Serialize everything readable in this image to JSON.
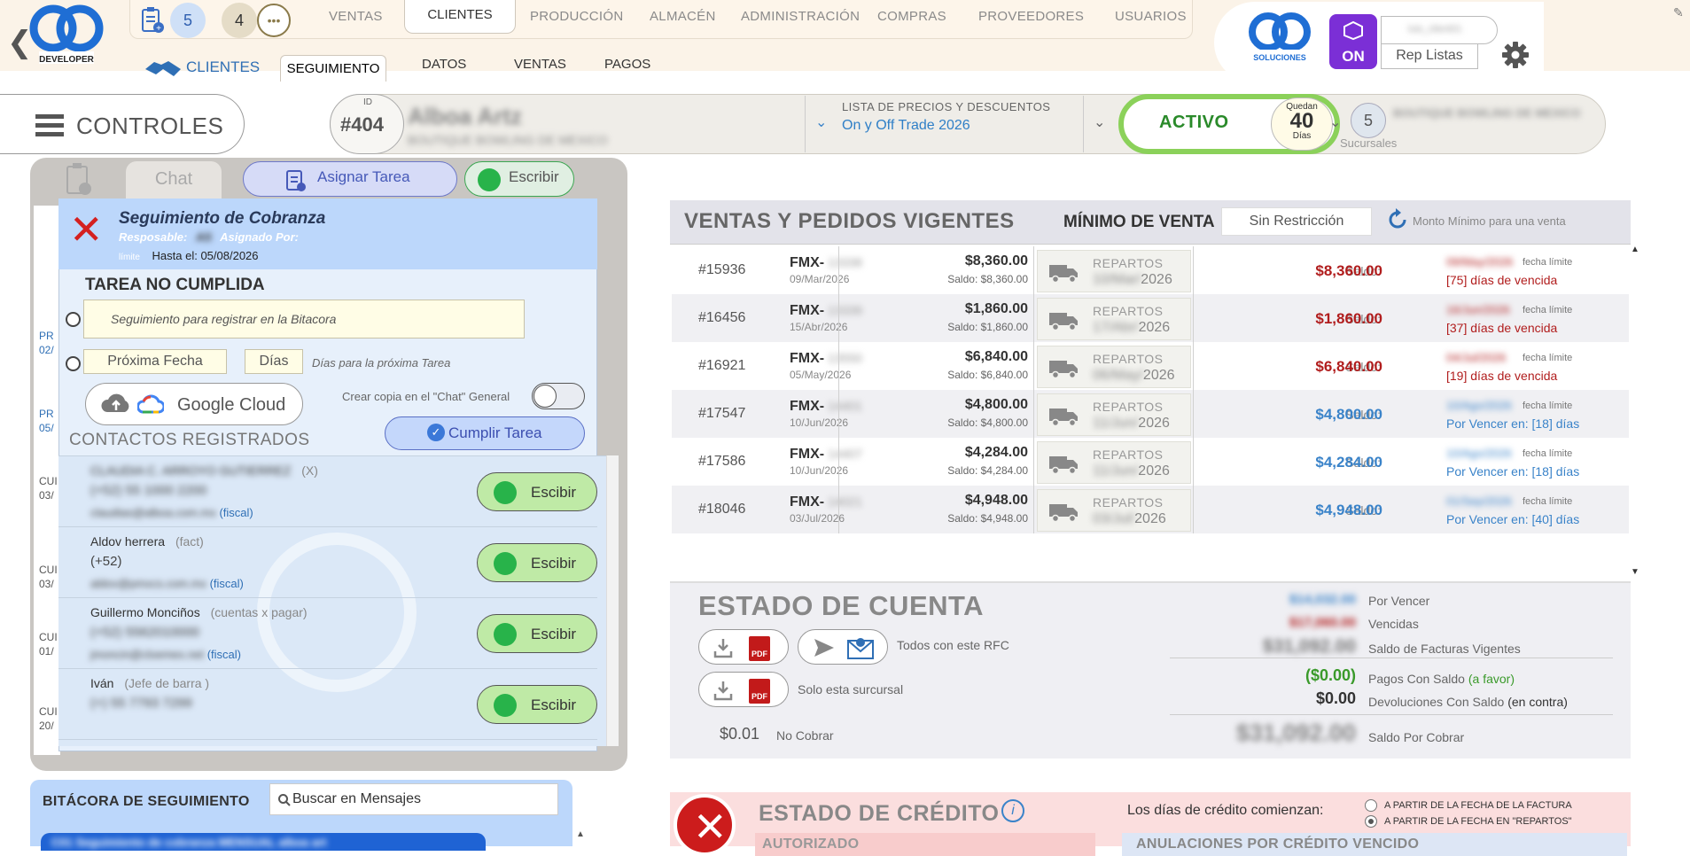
{
  "brand": {
    "logo_text": "99",
    "logo_sub": "DEVELOPER",
    "right_logo_text": "99",
    "right_logo_sub": "SOLUCIONES"
  },
  "top": {
    "badge_tasks": "5",
    "badge_chat": "4",
    "modules": [
      "VENTAS",
      "CLIENTES",
      "PRODUCCIÓN",
      "ALMACÉN",
      "ADMINISTRACIÓN",
      "COMPRAS",
      "PROVEEDORES",
      "USUARIOS"
    ],
    "active_module": "CLIENTES",
    "section_label": "CLIENTES",
    "subtabs": [
      "SEGUIMIENTO",
      "DATOS",
      "VENTAS",
      "PAGOS"
    ],
    "on_label": "ON",
    "rep_listas": "Rep Listas",
    "user_name": "luis_client01"
  },
  "controls": {
    "label": "CONTROLES"
  },
  "client": {
    "id_label": "ID",
    "id": "#404",
    "name": "Alboa Artz",
    "name2": "BOUTIQUE BOWLING DE MEXICO",
    "lista_label": "LISTA DE PRECIOS Y DESCUENTOS",
    "lista_value": "On y Off Trade 2026",
    "status": "ACTIVO",
    "quedan_label": "Quedan",
    "quedan_value": "40",
    "quedan_unit": "Días",
    "sucursales_count": "5",
    "sucursales_label": "Sucursales",
    "sucursal_name": "BOUTIQUE BOWLING DE MEXICO"
  },
  "left": {
    "chat_tab": "Chat",
    "asignar": "Asignar  Tarea",
    "escribir": "Escribir",
    "side_chips": [
      "PR",
      "02/",
      "PR",
      "05/",
      "CUI",
      "03/",
      "CUI",
      "03/",
      "CUI",
      "01/",
      "CUI",
      "20/"
    ]
  },
  "popup": {
    "title": "Seguimiento de Cobranza",
    "responsable": "Resposable:",
    "responsable_val": "AS",
    "asignado": "Asignado Por:",
    "limite": "límite",
    "hasta": "Hasta el: 05/08/2026",
    "tarea_status": "TAREA NO CUMPLIDA",
    "seg_placeholder": "Seguimiento para registrar en la Bitacora",
    "prox_fecha": "Próxima Fecha",
    "dias": "Días",
    "dias_hint": "Días para la próxima Tarea",
    "gcloud": "Google Cloud",
    "copia": "Crear copia en el \"Chat\" General",
    "cumplir": "Cumplir Tarea",
    "contactos": "CONTACTOS REGISTRADOS",
    "contacts": [
      {
        "name": "CLAUDIA C. ARROYO GUTIERREZ",
        "tag": "(X)",
        "phone": "(+52) 55 1000 2200",
        "mail": "claudias@alboa.com.mx",
        "mail_tag": "(fiscal)",
        "button": "Escibir"
      },
      {
        "name": "Aldov herrera",
        "tag": "(fact)",
        "phone": "(+52)",
        "mail": "aldov@pmxcs.com.mx",
        "mail_tag": "(fiscal)",
        "button": "Escibir"
      },
      {
        "name": "Guillermo Monciños",
        "tag": "(cuentas x pagar)",
        "phone": "(+52) 5562010000",
        "mail": "jmoncin@cloemex.net",
        "mail_tag": "(fiscal)",
        "button": "Escibir"
      },
      {
        "name": "Iván",
        "tag": "(Jefe de barra )",
        "phone": "(+) 55 7793 7299",
        "mail": "",
        "mail_tag": "",
        "button": "Escibir"
      }
    ]
  },
  "bitacora": {
    "label": "BITÁCORA DE SEGUIMIENTO",
    "search_placeholder": "Buscar en Mensajes",
    "message_preview": "C01 Seguimiento de cobranza MENSUAL alboa art"
  },
  "ventas": {
    "title": "VENTAS Y PEDIDOS VIGENTES",
    "minimo_label": "MÍNIMO DE VENTA",
    "minimo_value": "Sin Restricción",
    "monto_label": "Monto Mínimo para una venta",
    "reparto_label": "REPARTOS",
    "saldo_label": "Saldo:",
    "limite_label": "fecha límite",
    "rows": [
      {
        "folio": "#15936",
        "fmx": "FMX-",
        "fmx_num": "13338",
        "date": "09/Mar/2026",
        "amount": "$8,360.00",
        "saldo_small": "Saldo: $8,360.00",
        "rep_date": "10/Mar/2026",
        "saldo": "$8,360.00",
        "limit_date": "09/May/2026",
        "status": "[75] días de vencida",
        "state": "vencida"
      },
      {
        "folio": "#16456",
        "fmx": "FMX-",
        "fmx_num": "13339",
        "date": "15/Abr/2026",
        "amount": "$1,860.00",
        "saldo_small": "Saldo: $1,860.00",
        "rep_date": "17/Abr/2026",
        "saldo": "$1,860.00",
        "limit_date": "16/Jun/2026",
        "status": "[37] días de vencida",
        "state": "vencida"
      },
      {
        "folio": "#16921",
        "fmx": "FMX-",
        "fmx_num": "13550",
        "date": "05/May/2026",
        "amount": "$6,840.00",
        "saldo_small": "Saldo: $6,840.00",
        "rep_date": "06/May/2026",
        "saldo": "$6,840.00",
        "limit_date": "04/Jul/2026",
        "status": "[19] días de vencida",
        "state": "vencida"
      },
      {
        "folio": "#17547",
        "fmx": "FMX-",
        "fmx_num": "14401",
        "date": "10/Jun/2026",
        "amount": "$4,800.00",
        "saldo_small": "Saldo: $4,800.00",
        "rep_date": "11/Jun/2026",
        "saldo": "$4,800.00",
        "limit_date": "10/Ago/2026",
        "status": "Por Vencer en: [18] días",
        "state": "por_vencer"
      },
      {
        "folio": "#17586",
        "fmx": "FMX-",
        "fmx_num": "14407",
        "date": "10/Jun/2026",
        "amount": "$4,284.00",
        "saldo_small": "Saldo: $4,284.00",
        "rep_date": "11/Jun/2026",
        "saldo": "$4,284.00",
        "limit_date": "10/Ago/2026",
        "status": "Por Vencer en: [18] días",
        "state": "por_vencer"
      },
      {
        "folio": "#18046",
        "fmx": "FMX-",
        "fmx_num": "14021",
        "date": "03/Jul/2026",
        "amount": "$4,948.00",
        "saldo_small": "Saldo: $4,948.00",
        "rep_date": "03/Jul/2026",
        "saldo": "$4,948.00",
        "limit_date": "01/Sep/2026",
        "status": "Por Vencer en: [40] días",
        "state": "por_vencer"
      }
    ]
  },
  "cuenta": {
    "title": "ESTADO DE CUENTA",
    "rfc_label": "Todos con este RFC",
    "suc_label": "Solo esta surcursal",
    "nocobrar_value": "$0.01",
    "nocobrar_label": "No Cobrar",
    "por_vencer_value": "$14,032.00",
    "por_vencer_label": "Por Vencer",
    "vencidas_value": "$17,060.00",
    "vencidas_label": "Vencidas",
    "facturas_value": "$31,092.00",
    "facturas_label": "Saldo de Facturas Vigentes",
    "pagos_value": "($0.00)",
    "pagos_label": "Pagos Con Saldo",
    "pagos_tag": "(a favor)",
    "devol_value": "$0.00",
    "devol_label": "Devoluciones Con Saldo",
    "devol_tag": "(en contra)",
    "total_value": "$31,092.00",
    "total_label": "Saldo Por Cobrar"
  },
  "credito": {
    "title": "ESTADO DE CRÉDITO",
    "autorizado": "AUTORIZADO",
    "dias_label": "Los días de crédito comienzan:",
    "opt1": "A PARTIR DE LA FECHA DE LA FACTURA",
    "opt2": "A PARTIR DE LA FECHA EN \"REPARTOS\"",
    "anulaciones": "ANULACIONES POR CRÉDITO VENCIDO"
  },
  "colors": {
    "accent_blue": "#3a83c9",
    "danger_red": "#b11d1d",
    "active_green": "#8bd15a",
    "whatsapp_green": "#28b34a",
    "on_purple": "#7b2fd6"
  }
}
